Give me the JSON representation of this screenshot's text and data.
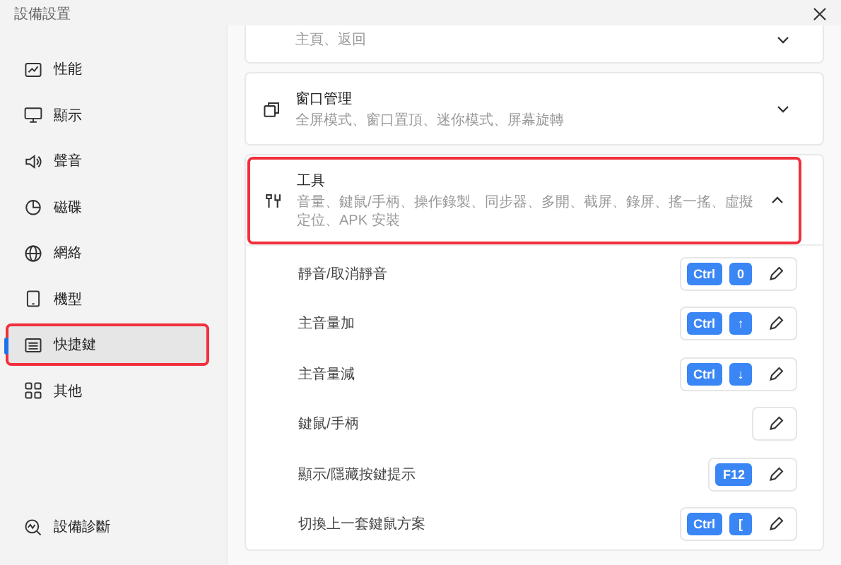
{
  "window": {
    "title": "設備設置"
  },
  "sidebar": {
    "items": [
      {
        "label": "性能",
        "selected": false,
        "highlighted": false
      },
      {
        "label": "顯示",
        "selected": false,
        "highlighted": false
      },
      {
        "label": "聲音",
        "selected": false,
        "highlighted": false
      },
      {
        "label": "磁碟",
        "selected": false,
        "highlighted": false
      },
      {
        "label": "網絡",
        "selected": false,
        "highlighted": false
      },
      {
        "label": "機型",
        "selected": false,
        "highlighted": false
      },
      {
        "label": "快捷鍵",
        "selected": true,
        "highlighted": true
      },
      {
        "label": "其他",
        "selected": false,
        "highlighted": false
      }
    ],
    "footer": {
      "label": "設備診斷"
    }
  },
  "sections": [
    {
      "description": "主頁、返回",
      "expanded": false,
      "highlighted": false
    },
    {
      "title": "窗口管理",
      "description": "全屏模式、窗口置頂、迷你模式、屏幕旋轉",
      "expanded": false,
      "highlighted": false
    },
    {
      "title": "工具",
      "description": "音量、鍵鼠/手柄、操作錄製、同步器、多開、截屏、錄屏、搖一搖、虛擬定位、APK 安裝",
      "expanded": true,
      "highlighted": true,
      "shortcuts": [
        {
          "label": "靜音/取消靜音",
          "keys": [
            "Ctrl",
            "0"
          ]
        },
        {
          "label": "主音量加",
          "keys": [
            "Ctrl",
            "↑"
          ]
        },
        {
          "label": "主音量減",
          "keys": [
            "Ctrl",
            "↓"
          ]
        },
        {
          "label": "鍵鼠/手柄"
        },
        {
          "label": "顯示/隱藏按鍵提示",
          "keys": [
            "F12"
          ]
        },
        {
          "label": "切換上一套鍵鼠方案",
          "keys": [
            "Ctrl",
            "["
          ]
        }
      ]
    }
  ]
}
